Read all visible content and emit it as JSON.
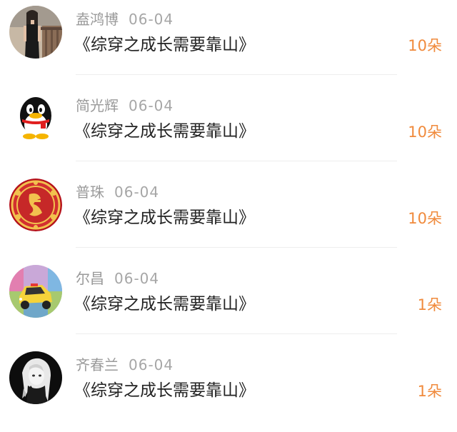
{
  "gifts": [
    {
      "user": "盍鸿博",
      "date": "06-04",
      "book": "《综穿之成长需要靠山》",
      "amount": "10朵",
      "avatar_icon": "woman-photo-icon"
    },
    {
      "user": "简光辉",
      "date": "06-04",
      "book": "《综穿之成长需要靠山》",
      "amount": "10朵",
      "avatar_icon": "penguin-icon"
    },
    {
      "user": "普珠",
      "date": "06-04",
      "book": "《综穿之成长需要靠山》",
      "amount": "10朵",
      "avatar_icon": "fortune-medallion-icon"
    },
    {
      "user": "尔昌",
      "date": "06-04",
      "book": "《综穿之成长需要靠山》",
      "amount": "1朵",
      "avatar_icon": "yellow-car-icon"
    },
    {
      "user": "齐春兰",
      "date": "06-04",
      "book": "《综穿之成长需要靠山》",
      "amount": "1朵",
      "avatar_icon": "anime-girl-icon"
    }
  ],
  "colors": {
    "amount": "#f08a3c",
    "username": "#9a9a9a",
    "title": "#222222",
    "divider": "#eeeeee"
  }
}
